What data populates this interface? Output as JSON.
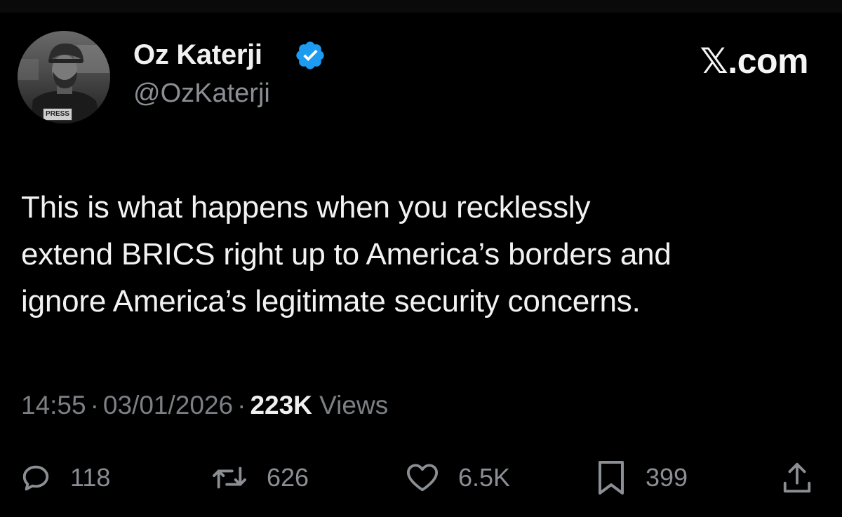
{
  "author": {
    "name": "Oz Katerji",
    "handle": "@OzKaterji",
    "avatar_badge_text": "PRESS",
    "verified": true
  },
  "brand": {
    "logo_text": "𝕏.com",
    "logo_suffix": ".com",
    "logo_mark": "𝕏"
  },
  "tweet": {
    "text_lines": [
      "This is what happens when you recklessly",
      "extend BRICS right up to America’s borders and",
      "ignore America’s legitimate security concerns."
    ]
  },
  "meta": {
    "time": "14:55",
    "separator": "·",
    "date": "03/01/2026",
    "views_count": "223K",
    "views_label": "Views"
  },
  "actions": {
    "replies": "118",
    "reposts": "626",
    "likes": "6.5K",
    "bookmarks": "399"
  },
  "colors": {
    "background": "#000000",
    "text_primary": "#f2f2f2",
    "text_secondary": "#8b8f94",
    "verified_blue": "#1d9bf0"
  },
  "icons": {
    "reply": "reply-icon",
    "repost": "repost-icon",
    "like": "like-icon",
    "bookmark": "bookmark-icon",
    "share": "share-icon",
    "verified": "verified-badge-icon"
  }
}
